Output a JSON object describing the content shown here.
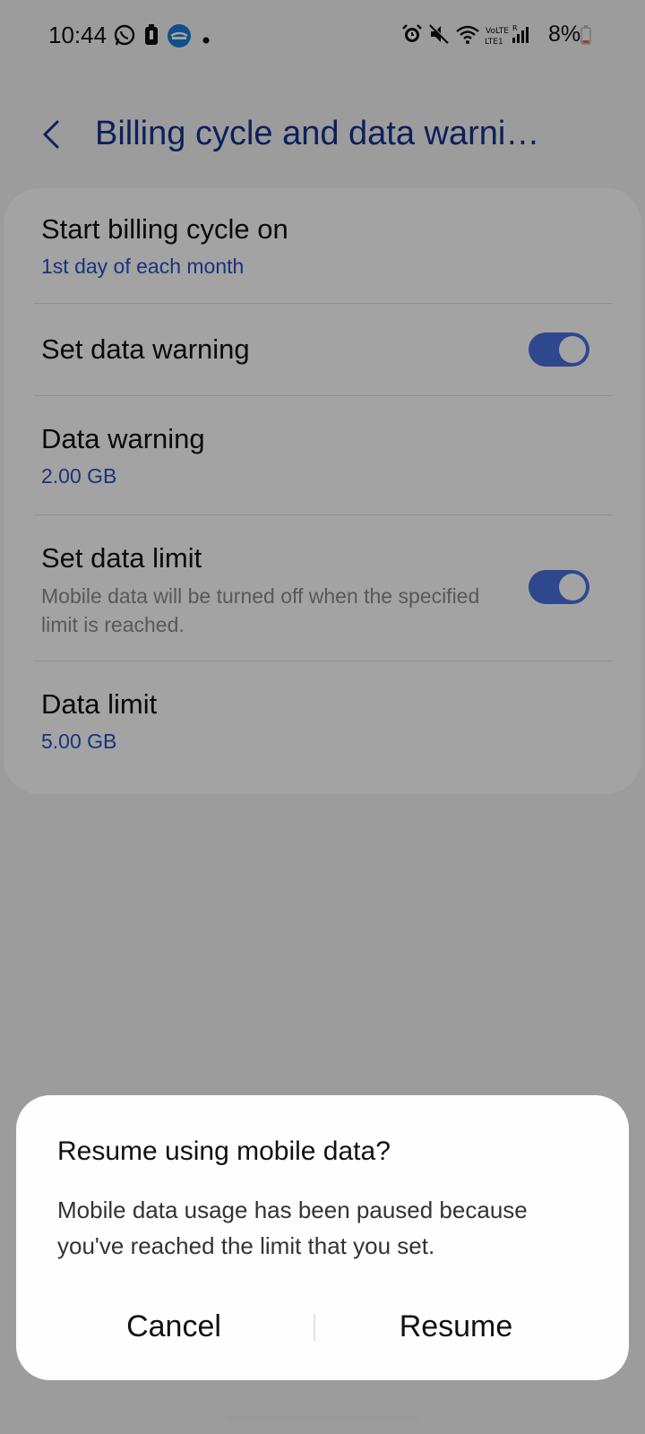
{
  "status_bar": {
    "time": "10:44",
    "battery_percent": "8%",
    "network_text": "VoLTE1",
    "network_sub": "LTE1",
    "icons": [
      "whatsapp-icon",
      "battery-saver-icon",
      "app-notification-icon",
      "dot-icon",
      "alarm-icon",
      "mute-icon",
      "wifi-icon",
      "signal-icon",
      "battery-icon"
    ]
  },
  "app_bar": {
    "title": "Billing cycle and data warni…"
  },
  "settings": {
    "billing_cycle": {
      "title": "Start billing cycle on",
      "value": "1st day of each month"
    },
    "set_data_warning": {
      "title": "Set data warning",
      "enabled": true
    },
    "data_warning": {
      "title": "Data warning",
      "value": "2.00 GB"
    },
    "set_data_limit": {
      "title": "Set data limit",
      "description": "Mobile data will be turned off when the specified limit is reached.",
      "enabled": true
    },
    "data_limit": {
      "title": "Data limit",
      "value": "5.00 GB"
    }
  },
  "dialog": {
    "title": "Resume using mobile data?",
    "message": "Mobile data usage has been paused because you've reached the limit that you set.",
    "cancel_label": "Cancel",
    "resume_label": "Resume"
  },
  "colors": {
    "accent": "#4a6fe0",
    "title_blue": "#14328f",
    "value_blue": "#2851c4"
  }
}
